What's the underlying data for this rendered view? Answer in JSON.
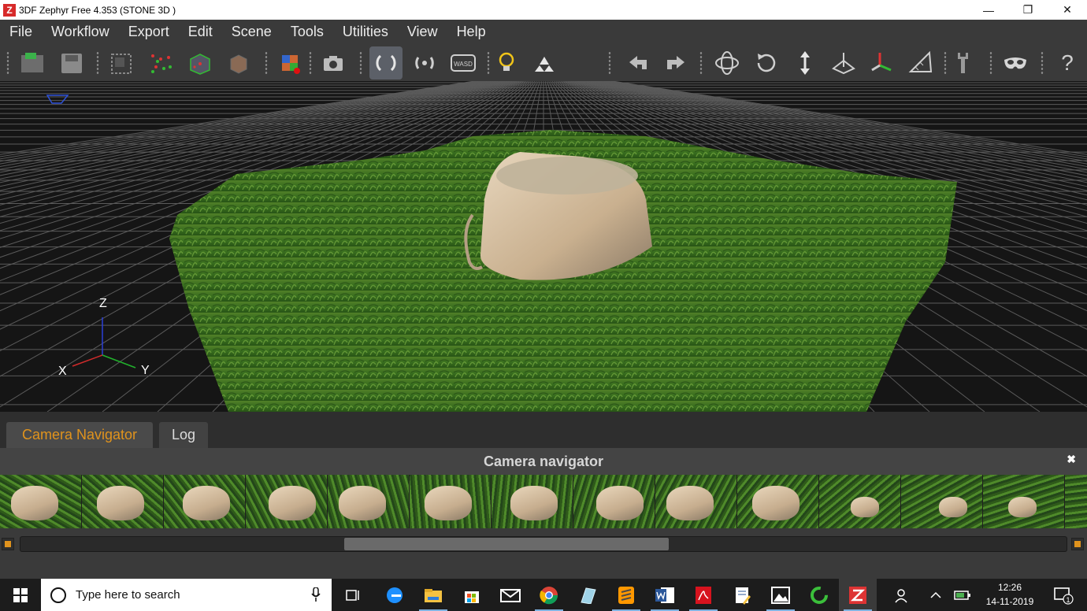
{
  "window": {
    "title": "3DF Zephyr Free 4.353 (STONE 3D )",
    "logo_letter": "Z",
    "controls": {
      "minimize": "—",
      "restore": "❐",
      "close": "✕"
    }
  },
  "menu": {
    "items": [
      "File",
      "Workflow",
      "Export",
      "Edit",
      "Scene",
      "Tools",
      "Utilities",
      "View",
      "Help"
    ]
  },
  "toolbar": {
    "buttons": [
      "new-project",
      "save-project",
      "sparse-reconstruction",
      "dense-cloud",
      "mesh",
      "textured-mesh",
      "render-cube",
      "camera",
      "orbit-rotate",
      "orbit-pivot",
      "wasd-navigation",
      "light",
      "flat-shading",
      "undo",
      "redo",
      "orbit-mode",
      "reset-view",
      "vertical-axis",
      "plane-tool",
      "gizmo-axes",
      "measure-tool",
      "settings",
      "stereo-mask",
      "help"
    ],
    "wasd_label": "WASD",
    "active_button": "orbit-rotate",
    "help_glyph": "?"
  },
  "viewport": {
    "axis_labels": {
      "z": "Z",
      "x": "X",
      "y": "Y"
    }
  },
  "bottom_panel": {
    "tabs": [
      {
        "label": "Camera Navigator",
        "active": true
      },
      {
        "label": "Log",
        "active": false
      }
    ],
    "title": "Camera navigator",
    "close_glyph": "✖",
    "thumbnail_count": 14
  },
  "taskbar": {
    "search_placeholder": "Type here to search",
    "time": "12:26",
    "date": "14-11-2019",
    "notification_count": "1",
    "colors": {
      "accent": "#e0931d",
      "taskbar": "#1c1c1c"
    }
  }
}
